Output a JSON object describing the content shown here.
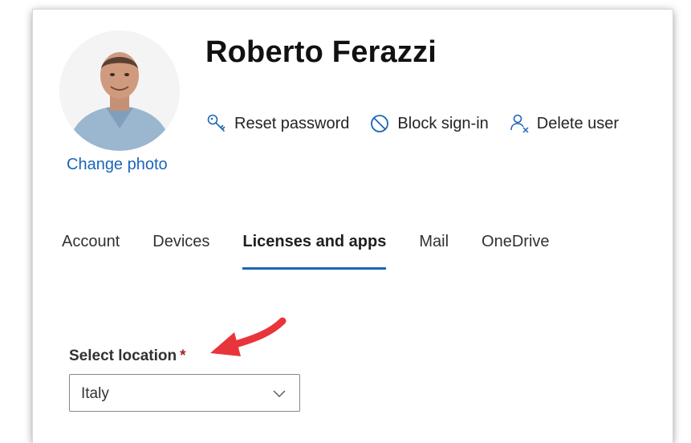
{
  "user": {
    "name": "Roberto Ferazzi",
    "change_photo": "Change photo"
  },
  "actions": [
    {
      "label": "Reset password",
      "icon": "key-icon"
    },
    {
      "label": "Block sign-in",
      "icon": "block-icon"
    },
    {
      "label": "Delete user",
      "icon": "delete-user-icon"
    }
  ],
  "tabs": [
    {
      "label": "Account",
      "active": false
    },
    {
      "label": "Devices",
      "active": false
    },
    {
      "label": "Licenses and apps",
      "active": true
    },
    {
      "label": "Mail",
      "active": false
    },
    {
      "label": "OneDrive",
      "active": false
    }
  ],
  "location": {
    "label": "Select location",
    "required_marker": "*",
    "value": "Italy"
  },
  "colors": {
    "accent": "#1a66b8",
    "required": "#a4262c",
    "annotation_arrow": "#e8353b"
  }
}
